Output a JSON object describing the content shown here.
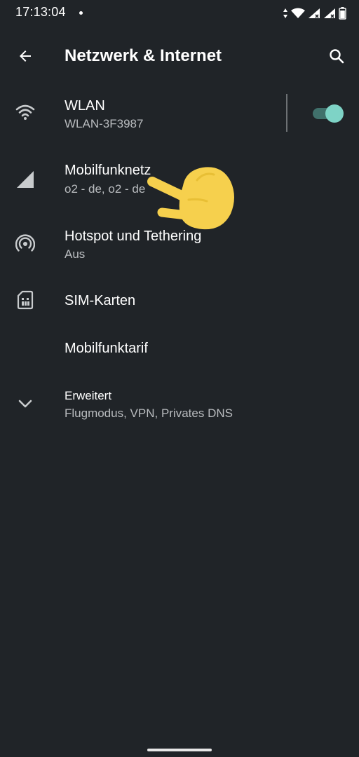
{
  "status_bar": {
    "time": "17:13:04",
    "icons": [
      "notification-dot",
      "data-activity-icon",
      "wifi-icon",
      "signal-icon-sim1",
      "signal-icon-sim2",
      "battery-icon"
    ]
  },
  "app_bar": {
    "title": "Netzwerk & Internet",
    "back_icon": "arrow-back-icon",
    "search_icon": "search-icon"
  },
  "items": [
    {
      "title": "WLAN",
      "subtitle": "WLAN-3F3987",
      "icon": "wifi-icon",
      "toggle_on": true
    },
    {
      "title": "Mobilfunknetz",
      "subtitle": "o2 - de, o2 - de",
      "icon": "cell-signal-icon"
    },
    {
      "title": "Hotspot und Tethering",
      "subtitle": "Aus",
      "icon": "hotspot-icon"
    },
    {
      "title": "SIM-Karten",
      "subtitle": "",
      "icon": "sim-card-icon"
    },
    {
      "title": "Mobilfunktarif",
      "subtitle": "",
      "icon": ""
    },
    {
      "title": "Erweitert",
      "subtitle": "Flugmodus, VPN, Privates DNS",
      "icon": "chevron-down-icon"
    }
  ],
  "colors": {
    "background": "#202428",
    "text_primary": "#ffffff",
    "text_secondary": "#b9bcbf",
    "toggle_thumb": "#7ed3c6",
    "toggle_track": "#40706b",
    "pointer_hand": "#f6d04d"
  }
}
